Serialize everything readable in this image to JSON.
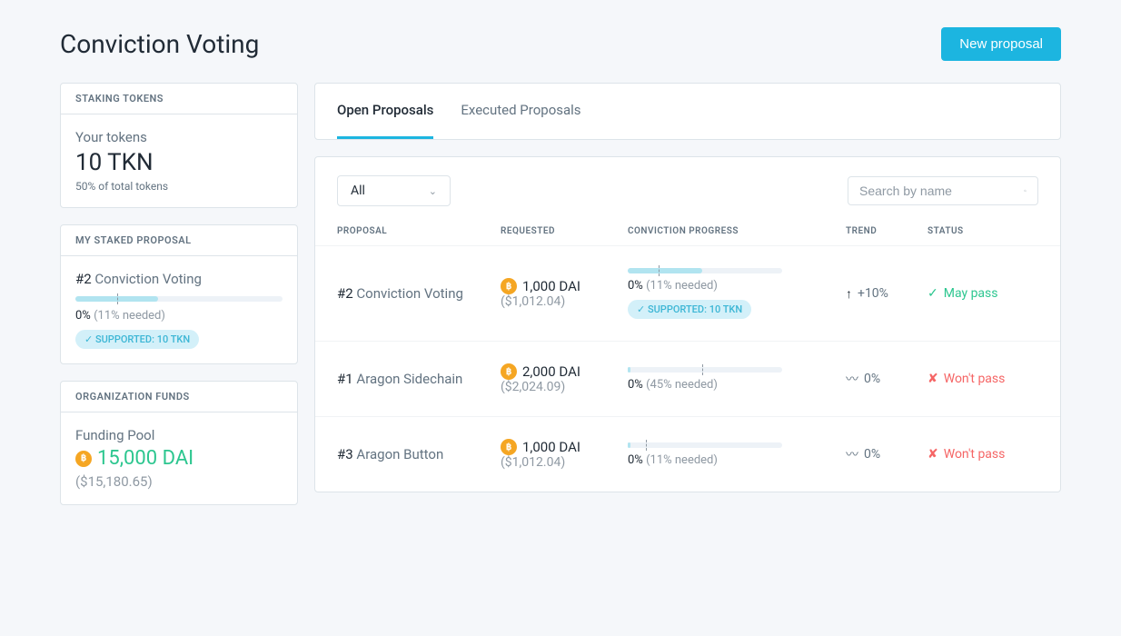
{
  "header": {
    "title": "Conviction Voting",
    "new_proposal_label": "New proposal"
  },
  "sidebar": {
    "staking": {
      "header": "STAKING TOKENS",
      "tokens_label": "Your tokens",
      "tokens_value": "10 TKN",
      "share": "50% of total tokens"
    },
    "staked_proposal": {
      "header": "MY STAKED PROPOSAL",
      "pid": "#2",
      "name": "Conviction Voting",
      "progress_pct": "0%",
      "needed": "(11% needed)",
      "badge": "✓ SUPPORTED: 10 TKN",
      "fill": 40,
      "mark": 20
    },
    "funds": {
      "header": "ORGANIZATION FUNDS",
      "pool_label": "Funding Pool",
      "amount": "15,000 DAI",
      "fiat": "($15,180.65)"
    }
  },
  "tabs": {
    "open": "Open Proposals",
    "executed": "Executed Proposals"
  },
  "filters": {
    "selected": "All",
    "search_placeholder": "Search by name"
  },
  "columns": {
    "proposal": "PROPOSAL",
    "requested": "REQUESTED",
    "conviction": "CONVICTION PROGRESS",
    "trend": "TREND",
    "status": "STATUS"
  },
  "rows": [
    {
      "pid": "#2",
      "name": "Conviction Voting",
      "amount": "1,000 DAI",
      "fiat": "($1,012.04)",
      "progress_pct": "0%",
      "needed": "(11% needed)",
      "fill": 48,
      "mark": 20,
      "supported_badge": "✓ SUPPORTED: 10 TKN",
      "trend_icon": "up",
      "trend": "+10%",
      "status_type": "pass",
      "status_icon": "✓",
      "status": "May pass"
    },
    {
      "pid": "#1",
      "name": "Aragon Sidechain",
      "amount": "2,000 DAI",
      "fiat": "($2,024.09)",
      "progress_pct": "0%",
      "needed": "(45% needed)",
      "fill": 2,
      "mark": 48,
      "supported_badge": "",
      "trend_icon": "flat",
      "trend": "0%",
      "status_type": "fail",
      "status_icon": "✘",
      "status": "Won't pass"
    },
    {
      "pid": "#3",
      "name": "Aragon Button",
      "amount": "1,000 DAI",
      "fiat": "($1,012.04)",
      "progress_pct": "0%",
      "needed": "(11% needed)",
      "fill": 2,
      "mark": 12,
      "supported_badge": "",
      "trend_icon": "flat",
      "trend": "0%",
      "status_type": "fail",
      "status_icon": "✘",
      "status": "Won't pass"
    }
  ]
}
